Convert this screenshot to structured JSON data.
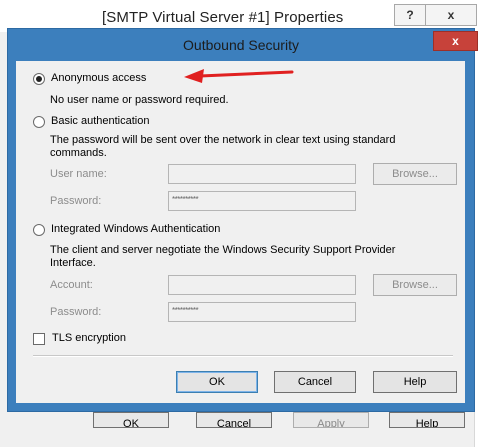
{
  "parent_window": {
    "title": "[SMTP Virtual Server #1] Properties",
    "help_label": "?",
    "close_label": "x",
    "buttons": [
      "OK",
      "Cancel",
      "Apply",
      "Help"
    ]
  },
  "dialog": {
    "title": "Outbound Security",
    "close_label": "x",
    "anonymous": {
      "label": "Anonymous access",
      "description": "No user name or password required.",
      "selected": true
    },
    "basic": {
      "label": "Basic authentication",
      "description_line1": "The password will be sent over the network in clear text using standard",
      "description_line2": "commands.",
      "user_name_label": "User name:",
      "user_name_value": "",
      "browse_label": "Browse...",
      "password_label": "Password:",
      "password_mask": "**********"
    },
    "integrated": {
      "label": "Integrated Windows Authentication",
      "description_line1": "The client and server negotiate the Windows Security Support Provider",
      "description_line2": "Interface.",
      "account_label": "Account:",
      "account_value": "",
      "browse_label": "Browse...",
      "password_label": "Password:",
      "password_mask": "**********"
    },
    "tls": {
      "label": "TLS encryption",
      "checked": false
    },
    "ok_label": "OK",
    "cancel_label": "Cancel",
    "help_label": "Help"
  },
  "colors": {
    "dialog_frame": "#3c7fbd",
    "dialog_close": "#c7423a",
    "arrow": "#e02020"
  }
}
